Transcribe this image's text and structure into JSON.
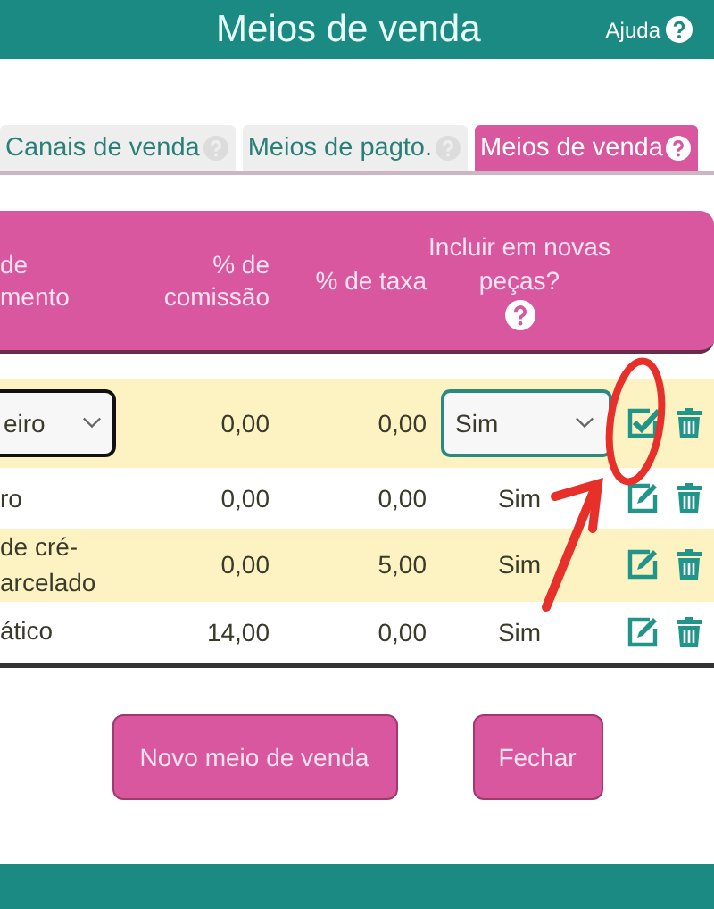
{
  "header": {
    "title": "Meios de venda",
    "help": "Ajuda"
  },
  "tabs": [
    {
      "label": "Canais de venda",
      "selected": false
    },
    {
      "label": "Meios de pagto.",
      "selected": false
    },
    {
      "label": "Meios de venda",
      "selected": true
    }
  ],
  "table": {
    "columns": [
      "de\nmento",
      "% de\ncomissão",
      "% de taxa",
      "Incluir em novas peças?"
    ],
    "rows": [
      {
        "kind": "editing",
        "name": "eiro",
        "commission": "0,00",
        "fee": "0,00",
        "include": "Sim"
      },
      {
        "kind": "view",
        "name": "ro",
        "commission": "0,00",
        "fee": "0,00",
        "include": "Sim"
      },
      {
        "kind": "view",
        "name": "de cré-\narcelado",
        "commission": "0,00",
        "fee": "5,00",
        "include": "Sim"
      },
      {
        "kind": "view",
        "name": "ático",
        "commission": "14,00",
        "fee": "0,00",
        "include": "Sim"
      }
    ]
  },
  "buttons": [
    "Novo meio de venda",
    "Fechar"
  ]
}
